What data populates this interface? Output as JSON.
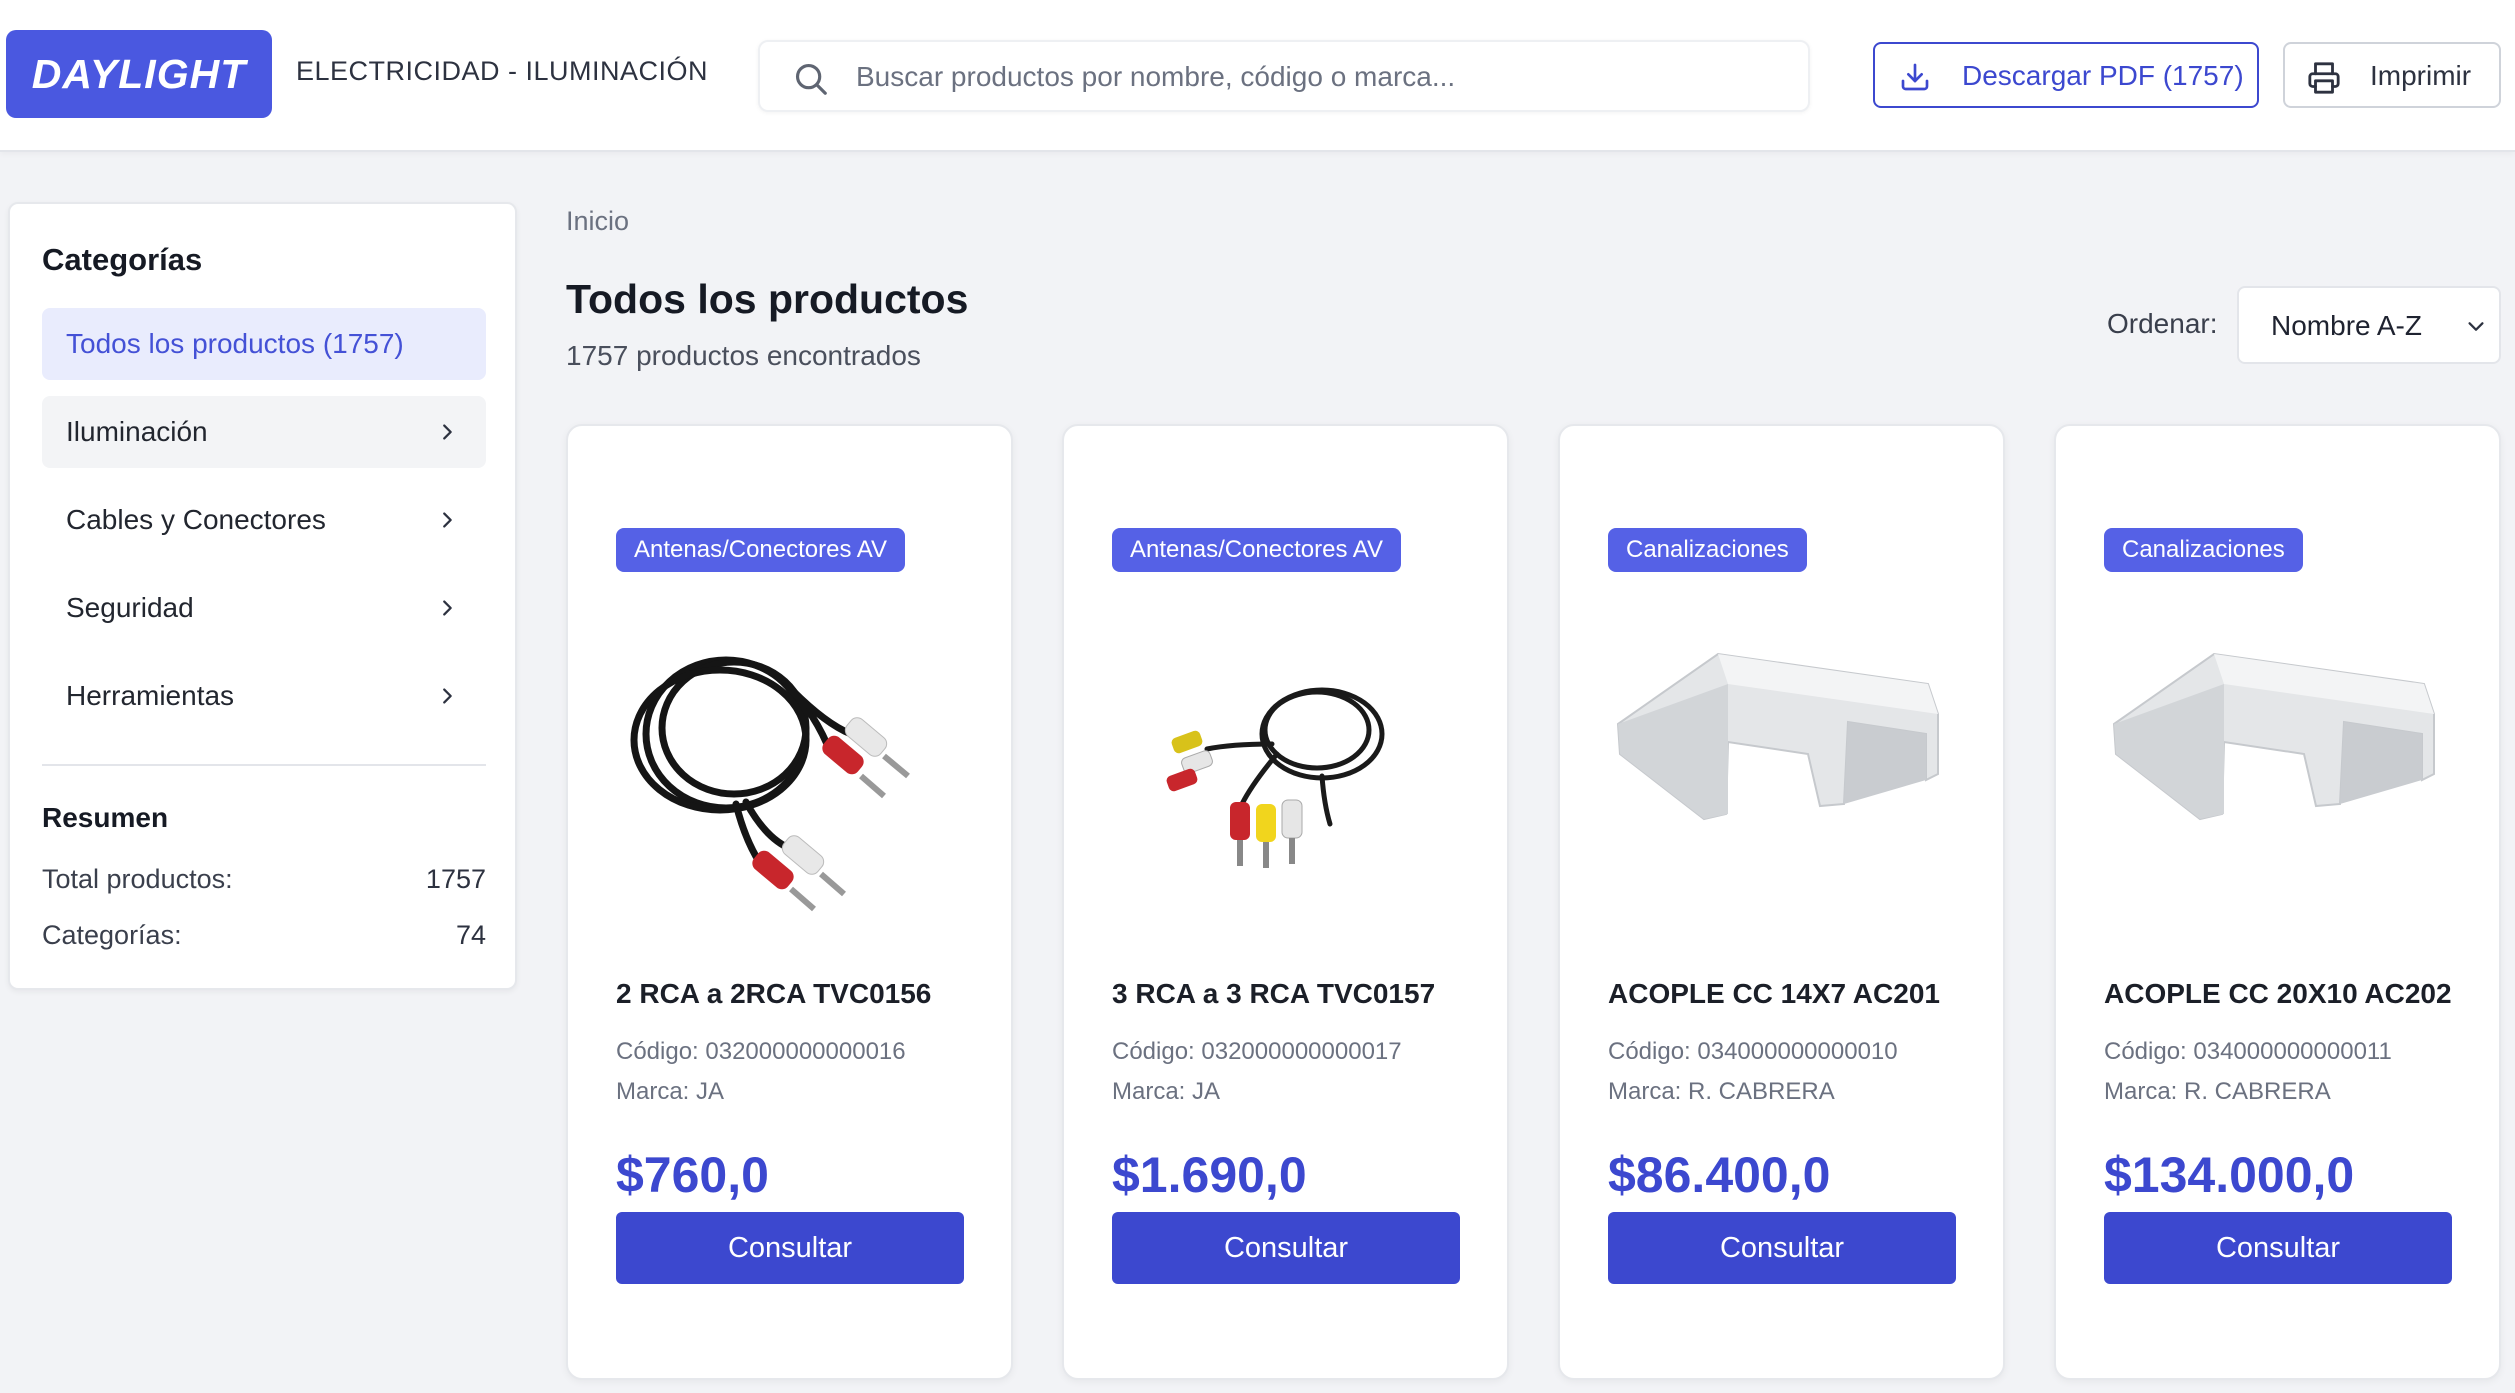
{
  "header": {
    "logo": "DAYLIGHT",
    "tagline": "ELECTRICIDAD - ILUMINACIÓN",
    "search_placeholder": "Buscar productos por nombre, código o marca...",
    "search_value": "",
    "pdf_button": "Descargar PDF (1757)",
    "print_button": "Imprimir",
    "accent_color": "#4a58e0"
  },
  "sidebar": {
    "title": "Categorías",
    "items": [
      {
        "label": "Todos los productos (1757)",
        "active": true
      },
      {
        "label": "Iluminación",
        "has_children": true
      },
      {
        "label": "Cables y Conectores",
        "has_children": true
      },
      {
        "label": "Seguridad",
        "has_children": true
      },
      {
        "label": "Herramientas",
        "has_children": true
      }
    ],
    "summary": {
      "title": "Resumen",
      "total_label": "Total productos:",
      "total_value": "1757",
      "categories_label": "Categorías:",
      "categories_value": "74"
    }
  },
  "main": {
    "breadcrumb": "Inicio",
    "title": "Todos los productos",
    "count_text": "1757 productos encontrados",
    "sort_label": "Ordenar:",
    "sort_value": "Nombre A-Z"
  },
  "products": [
    {
      "badge": "Antenas/Conectores AV",
      "name": "2 RCA a 2RCA TVC0156",
      "code": "Código: 032000000000016",
      "brand": "Marca: JA",
      "price": "$760,0",
      "button": "Consultar",
      "image": "rca-cable-red-white"
    },
    {
      "badge": "Antenas/Conectores AV",
      "name": "3 RCA a 3 RCA TVC0157",
      "code": "Código: 032000000000017",
      "brand": "Marca: JA",
      "price": "$1.690,0",
      "button": "Consultar",
      "image": "rca-cable-yellow-red-white"
    },
    {
      "badge": "Canalizaciones",
      "name": "ACOPLE CC 14X7 AC201",
      "code": "Código: 034000000000010",
      "brand": "Marca: R. CABRERA",
      "price": "$86.400,0",
      "button": "Consultar",
      "image": "white-channel-coupler"
    },
    {
      "badge": "Canalizaciones",
      "name": "ACOPLE CC 20X10 AC202",
      "code": "Código: 034000000000011",
      "brand": "Marca: R. CABRERA",
      "price": "$134.000,0",
      "button": "Consultar",
      "image": "white-channel-coupler"
    }
  ]
}
